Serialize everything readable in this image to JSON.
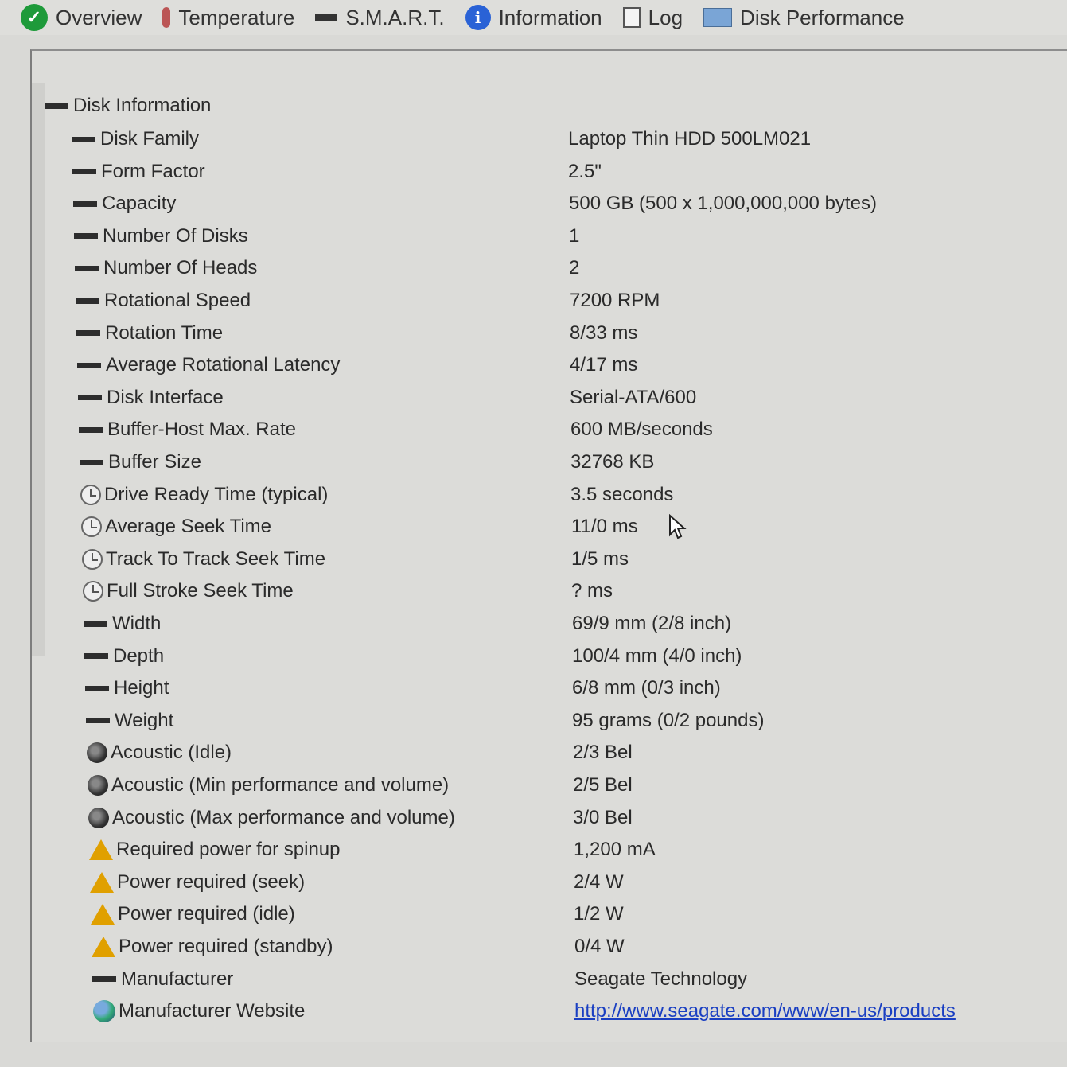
{
  "tabs": [
    {
      "label": "Overview",
      "icon": "check-circle-icon"
    },
    {
      "label": "Temperature",
      "icon": "thermometer-icon"
    },
    {
      "label": "S.M.A.R.T.",
      "icon": "dash-icon"
    },
    {
      "label": "Information",
      "icon": "info-icon"
    },
    {
      "label": "Log",
      "icon": "document-icon"
    },
    {
      "label": "Disk Performance",
      "icon": "performance-icon"
    }
  ],
  "tree": {
    "root_label": "Disk Information",
    "rows": [
      {
        "label": "Disk Family",
        "value": "Laptop Thin HDD 500LM021",
        "icon": "dash"
      },
      {
        "label": "Form Factor",
        "value": "2.5\"",
        "icon": "dash"
      },
      {
        "label": "Capacity",
        "value": "500 GB (500 x 1,000,000,000 bytes)",
        "icon": "dash"
      },
      {
        "label": "Number Of Disks",
        "value": "1",
        "icon": "dash"
      },
      {
        "label": "Number Of Heads",
        "value": "2",
        "icon": "dash"
      },
      {
        "label": "Rotational Speed",
        "value": "7200 RPM",
        "icon": "dash"
      },
      {
        "label": "Rotation Time",
        "value": "8/33 ms",
        "icon": "dash"
      },
      {
        "label": "Average Rotational Latency",
        "value": "4/17 ms",
        "icon": "dash"
      },
      {
        "label": "Disk Interface",
        "value": "Serial-ATA/600",
        "icon": "dash"
      },
      {
        "label": "Buffer-Host Max. Rate",
        "value": "600 MB/seconds",
        "icon": "dash"
      },
      {
        "label": "Buffer Size",
        "value": "32768 KB",
        "icon": "dash"
      },
      {
        "label": "Drive Ready Time (typical)",
        "value": "3.5 seconds",
        "icon": "clock"
      },
      {
        "label": "Average Seek Time",
        "value": "11/0 ms",
        "icon": "clock"
      },
      {
        "label": "Track To Track Seek Time",
        "value": "1/5 ms",
        "icon": "clock"
      },
      {
        "label": "Full Stroke Seek Time",
        "value": "? ms",
        "icon": "clock"
      },
      {
        "label": "Width",
        "value": "69/9 mm (2/8 inch)",
        "icon": "dash"
      },
      {
        "label": "Depth",
        "value": "100/4 mm (4/0 inch)",
        "icon": "dash"
      },
      {
        "label": "Height",
        "value": "6/8 mm (0/3 inch)",
        "icon": "dash"
      },
      {
        "label": "Weight",
        "value": "95 grams (0/2 pounds)",
        "icon": "dash"
      },
      {
        "label": "Acoustic (Idle)",
        "value": "2/3 Bel",
        "icon": "speaker"
      },
      {
        "label": "Acoustic (Min performance and volume)",
        "value": "2/5 Bel",
        "icon": "speaker"
      },
      {
        "label": "Acoustic (Max performance and volume)",
        "value": "3/0 Bel",
        "icon": "speaker"
      },
      {
        "label": "Required power for spinup",
        "value": "1,200 mA",
        "icon": "warning"
      },
      {
        "label": "Power required (seek)",
        "value": "2/4 W",
        "icon": "warning"
      },
      {
        "label": "Power required (idle)",
        "value": "1/2 W",
        "icon": "warning"
      },
      {
        "label": "Power required (standby)",
        "value": "0/4 W",
        "icon": "warning"
      },
      {
        "label": "Manufacturer",
        "value": "Seagate Technology",
        "icon": "dash"
      },
      {
        "label": "Manufacturer Website",
        "value": "http://www.seagate.com/www/en-us/products",
        "icon": "globe",
        "link": true
      }
    ]
  },
  "colors": {
    "link": "#1a3fc2",
    "background": "#dcdcd9",
    "text": "#2a2a2a"
  }
}
